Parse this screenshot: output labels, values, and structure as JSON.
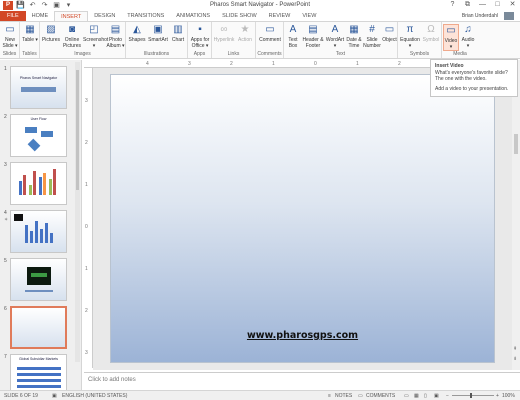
{
  "window": {
    "title": "Pharos Smart Navigator - PowerPoint",
    "app_badge": "P",
    "controls": [
      "?",
      "⧉",
      "—",
      "□",
      "✕"
    ]
  },
  "qat": [
    "💾",
    "↶",
    "↷",
    "▣",
    "▾"
  ],
  "tabs": [
    "FILE",
    "HOME",
    "INSERT",
    "DESIGN",
    "TRANSITIONS",
    "ANIMATIONS",
    "SLIDE SHOW",
    "REVIEW",
    "VIEW"
  ],
  "active_tab": "INSERT",
  "user": {
    "name": "Brian Underdahl"
  },
  "ribbon": {
    "groups": {
      "slides": "Slides",
      "tables": "Tables",
      "images": "Images",
      "illustrations": "Illustrations",
      "apps": "Apps",
      "links": "Links",
      "comments": "Comments",
      "text": "Text",
      "symbols": "Symbols",
      "media": "Media"
    },
    "buttons": {
      "new_slide": "New Slide ▾",
      "table": "Table ▾",
      "pictures": "Pictures",
      "online_pictures": "Online Pictures",
      "screenshot": "Screenshot ▾",
      "photo_album": "Photo Album ▾",
      "shapes": "Shapes",
      "smartart": "SmartArt",
      "chart": "Chart",
      "apps_for_office": "Apps for Office ▾",
      "hyperlink": "Hyperlink",
      "action": "Action",
      "comment": "Comment",
      "text_box": "Text Box",
      "header_footer": "Header & Footer",
      "wordart": "WordArt ▾",
      "date_time": "Date & Time",
      "slide_number": "Slide Number",
      "object": "Object",
      "equation": "Equation ▾",
      "symbol": "Symbol",
      "video": "Video ▾",
      "audio": "Audio ▾"
    }
  },
  "tooltip": {
    "title": "Insert Video",
    "line1": "What's everyone's favorite slide?",
    "line2": "The one with the video.",
    "line3": "Add a video to your presentation."
  },
  "thumbnails": [
    {
      "num": "1",
      "title": "Pharos Smart Navigator"
    },
    {
      "num": "2",
      "title": "User Flow"
    },
    {
      "num": "3",
      "title": ""
    },
    {
      "num": "4",
      "title": ""
    },
    {
      "num": "5",
      "title": ""
    },
    {
      "num": "6",
      "title": ""
    },
    {
      "num": "7",
      "title": "Global Subsidiar Markets"
    }
  ],
  "ruler": {
    "h_ticks": [
      "4",
      "3",
      "2",
      "1",
      "0",
      "1",
      "2",
      "3",
      "4"
    ],
    "v_ticks": [
      "3",
      "2",
      "1",
      "0",
      "1",
      "2",
      "3"
    ]
  },
  "slide": {
    "url_text": "www.pharosgps.com"
  },
  "notes_placeholder": "Click to add notes",
  "status": {
    "slide_of": "SLIDE 6 OF 19",
    "language": "ENGLISH (UNITED STATES)",
    "notes": "NOTES",
    "comments": "COMMENTS",
    "zoom": "100%"
  },
  "colors": {
    "accent": "#d24726",
    "ribbon_icon": "#2b579a"
  }
}
